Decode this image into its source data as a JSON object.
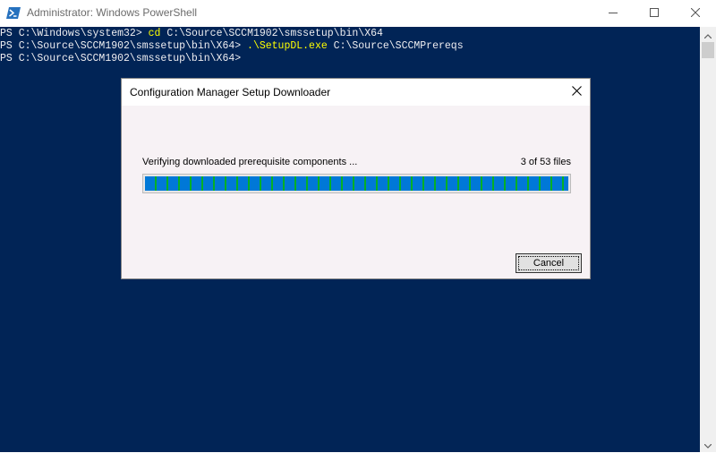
{
  "window": {
    "title": "Administrator: Windows PowerShell"
  },
  "console": {
    "lines": [
      {
        "prompt": "PS C:\\Windows\\system32> ",
        "command": "cd",
        "args": " C:\\Source\\SCCM1902\\smssetup\\bin\\X64"
      },
      {
        "prompt": "PS C:\\Source\\SCCM1902\\smssetup\\bin\\X64> ",
        "command": ".\\SetupDL.exe",
        "args": " C:\\Source\\SCCMPrereqs"
      },
      {
        "prompt": "PS C:\\Source\\SCCM1902\\smssetup\\bin\\X64>",
        "command": "",
        "args": ""
      }
    ]
  },
  "dialog": {
    "title": "Configuration Manager Setup Downloader",
    "status": "Verifying downloaded prerequisite components ...",
    "count": "3 of 53 files",
    "progress_fraction": 1.0,
    "cancel_label": "Cancel"
  },
  "colors": {
    "console_bg": "#012456",
    "command": "#ffff00",
    "progress": "#0078d7"
  }
}
